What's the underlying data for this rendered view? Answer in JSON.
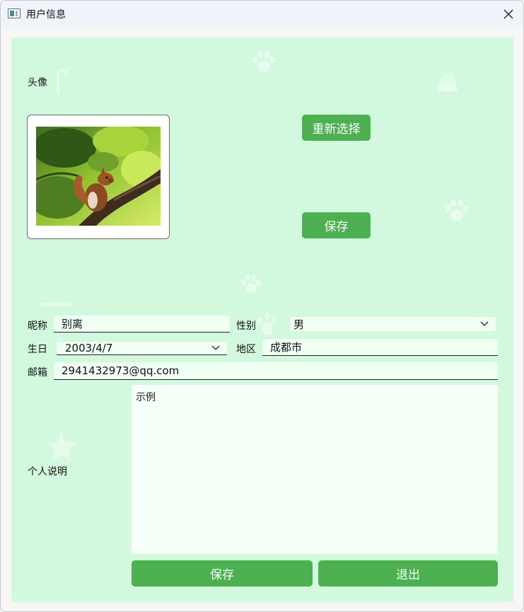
{
  "window": {
    "title": "用户信息"
  },
  "icons": {
    "app": "app-window-icon",
    "close": "close-icon",
    "dropdown": "chevron-down-icon",
    "decor": "paw-print-icon"
  },
  "colors": {
    "content_bg": "#d2f8de",
    "accent": "#4caf50",
    "field_bg": "#f0fff4"
  },
  "avatar": {
    "label": "头像",
    "reselect_label": "重新选择",
    "save_label": "保存"
  },
  "form": {
    "nickname_label": "昵称",
    "nickname_value": "别离",
    "gender_label": "性别",
    "gender_value": "男",
    "birthday_label": "生日",
    "birthday_value": "2003/4/7",
    "region_label": "地区",
    "region_value": "成都市",
    "email_label": "邮箱",
    "email_value": "2941432973@qq.com",
    "bio_label": "个人说明",
    "bio_value": "示例"
  },
  "actions": {
    "save_label": "保存",
    "exit_label": "退出"
  }
}
